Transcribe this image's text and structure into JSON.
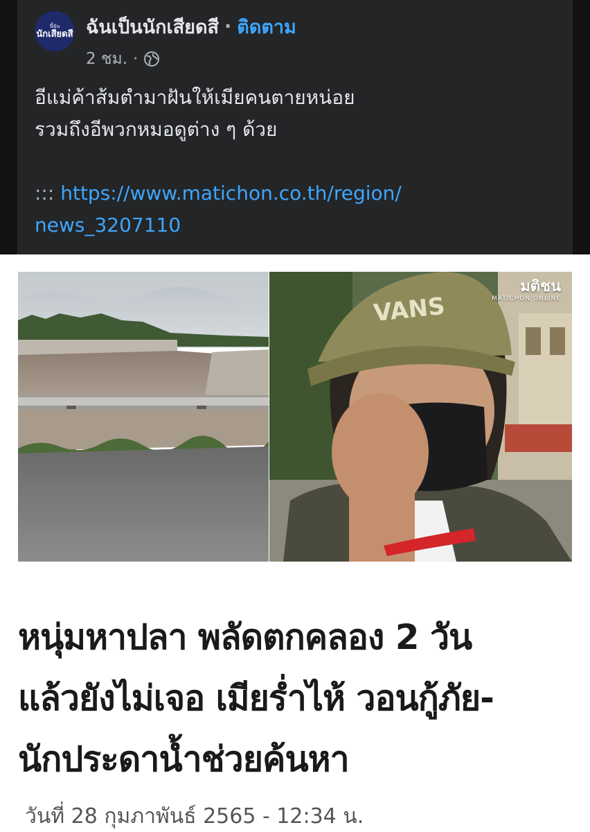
{
  "post": {
    "page_name": "ฉันเป็นนักเสียดสี",
    "separator": "·",
    "follow_label": "ติดตาม",
    "avatar_small": "นี้ฉัน",
    "avatar_name": "นักเสียดสี",
    "time": "2 ชม.",
    "meta_separator": "·",
    "privacy_icon": "globe-icon",
    "text_lines": [
      "อีแม่ค้าส้มตำมาฝันให้เมียคนตายหน่อย",
      "รวมถึงอีพวกหมอดูต่าง ๆ ด้วย"
    ],
    "link_prefix": ":::",
    "link_url_line1": "https://www.matichon.co.th/region/",
    "link_url_line2": "news_3207110"
  },
  "article": {
    "watermark_main": "มติชน",
    "watermark_sub": "MATICHON ONLINE",
    "cap_text": "VANS",
    "headline_lines": [
      "หนุ่มหาปลา พลัดตกคลอง 2 วัน",
      "แล้วยังไม่เจอ เมียร่ำไห้ วอนกู้ภัย-",
      "นักประดาน้ำช่วยค้นหา"
    ],
    "date": "วันที่ 28 กุมภาพันธ์ 2565 - 12:34 น."
  },
  "colors": {
    "dark_bg": "#121212",
    "panel_bg": "#242526",
    "text_primary": "#e4e6eb",
    "text_secondary": "#b0b3b8",
    "link": "#3ea6ff"
  }
}
